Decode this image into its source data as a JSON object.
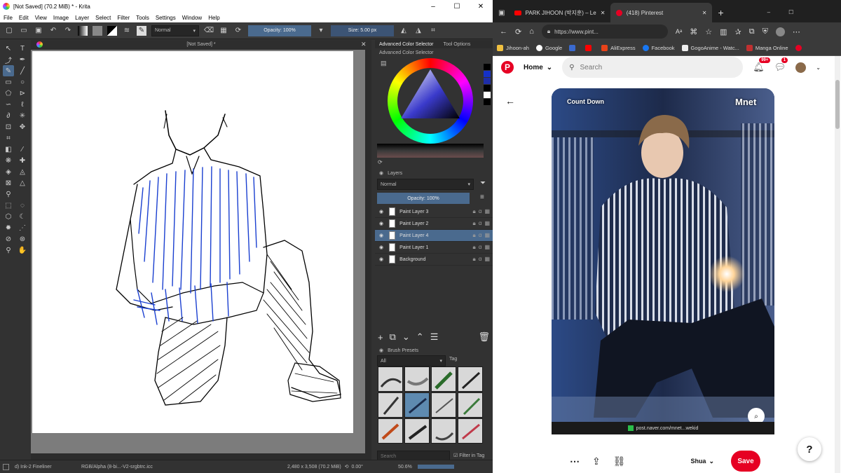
{
  "krita": {
    "window_title": "[Not Saved]  (70.2 MiB)  * - Krita",
    "menu": [
      "File",
      "Edit",
      "View",
      "Image",
      "Layer",
      "Select",
      "Filter",
      "Tools",
      "Settings",
      "Window",
      "Help"
    ],
    "toolbar": {
      "blend_mode": "Normal",
      "opacity_label": "Opacity: 100%",
      "size_label": "Size: 5.00 px"
    },
    "canvas_tab": "[Not Saved]  *",
    "dock_tabs": [
      "Advanced Color Selector",
      "Tool Options"
    ],
    "color_selector_title": "Advanced Color Selector",
    "layers": {
      "title": "Layers",
      "blend_mode": "Normal",
      "opacity_label": "Opacity:  100%",
      "items": [
        {
          "name": "Paint Layer 3",
          "active": false
        },
        {
          "name": "Paint Layer 2",
          "active": false
        },
        {
          "name": "Paint Layer 4",
          "active": true
        },
        {
          "name": "Paint Layer 1",
          "active": false
        },
        {
          "name": "Background",
          "active": false
        }
      ]
    },
    "brush_presets": {
      "title": "Brush Presets",
      "filter": "All",
      "tag_label": "Tag",
      "search_placeholder": "Search",
      "filter_in_tag": "Filter in Tag"
    },
    "status": {
      "brush": "d) Ink-2 Fineliner",
      "color_space": "RGB/Alpha (8-bi...-V2-srgbtrc.icc",
      "dimensions": "2,480 x 3,508 (70.2 MiB)",
      "rotation": "0.00°",
      "zoom": "50.6%"
    },
    "colors": {
      "accent": "#4a6a8e",
      "sketch_ink": "#000000",
      "sketch_blue": "#1a3fd0"
    }
  },
  "browser": {
    "tabs": [
      {
        "title": "PARK JIHOON (박지훈) – Let's Lo",
        "icon": "youtube-icon"
      },
      {
        "title": "(418) Pinterest",
        "icon": "pinterest-icon"
      }
    ],
    "url": "https://www.pint...",
    "bookmarks": [
      "Jihoon-ah",
      "Google",
      "",
      "",
      "AliExpress",
      "Facebook",
      "GogoAnime - Watc...",
      "Manga Online",
      ""
    ],
    "pinterest": {
      "home_label": "Home",
      "search_placeholder": "Search",
      "notifications_badge": "99+",
      "messages_badge": "1",
      "source_domain": "post.naver.com/mnet...wekid",
      "save_label": "Save",
      "board_name": "Shua",
      "help_label": "?",
      "image_labels": {
        "show_logo": "Count Down",
        "channel_logo": "Mnet"
      },
      "brand_color": "#e60023"
    }
  }
}
